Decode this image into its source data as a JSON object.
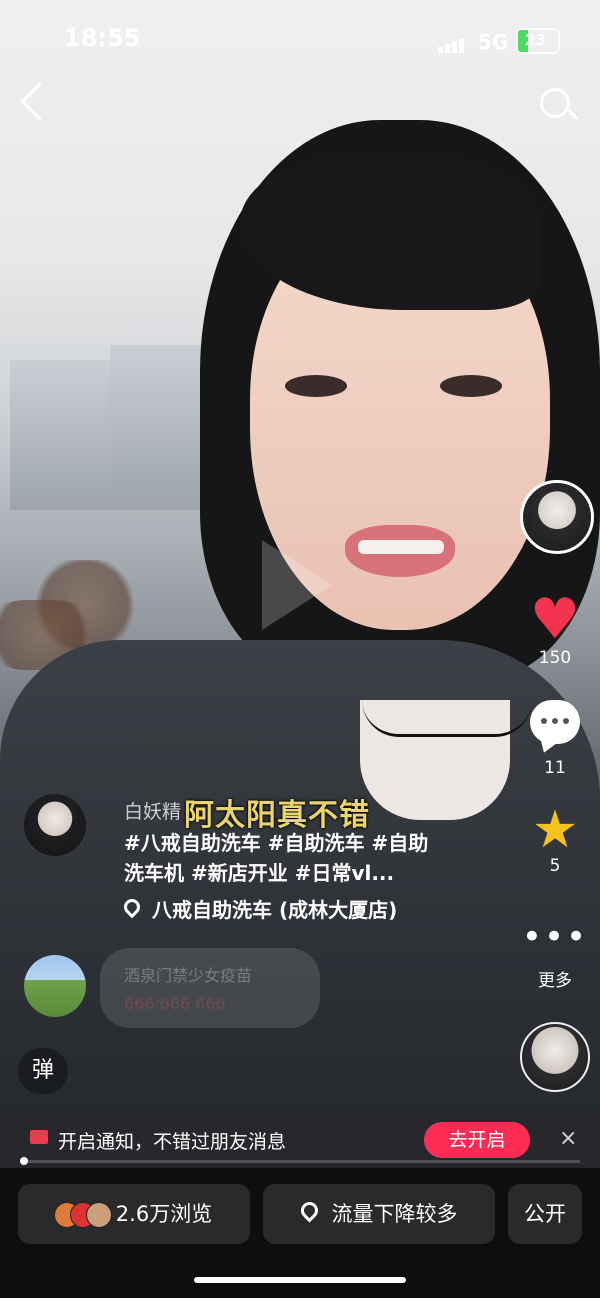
{
  "status_bar": {
    "time": "18:55",
    "network": "5G",
    "battery": "23"
  },
  "video": {
    "subtitle": "阿太阳真不错",
    "author": "白妖精",
    "hashtags": "#八戒自助洗车 #自助洗车 #自助洗车机 #新店开业 #日常vl...",
    "location": "八戒自助洗车 (成林大厦店)"
  },
  "right_rail": {
    "likes": "150",
    "comments": "11",
    "favorites": "5",
    "more_label": "更多"
  },
  "live_bubble": {
    "line1": "酒泉门禁少女疫苗",
    "line2": "666 666 666"
  },
  "danmu_label": "弹",
  "notification": {
    "text": "开启通知，不错过朋友消息",
    "button": "去开启",
    "close": "×"
  },
  "bottom_bar": {
    "views": "2.6万浏览",
    "traffic": "流量下降较多",
    "visibility": "公开"
  },
  "colors": {
    "accent": "#fe2c55",
    "heart": "#f4344f",
    "star": "#f8c11c",
    "subtitle": "#e9d56b"
  }
}
